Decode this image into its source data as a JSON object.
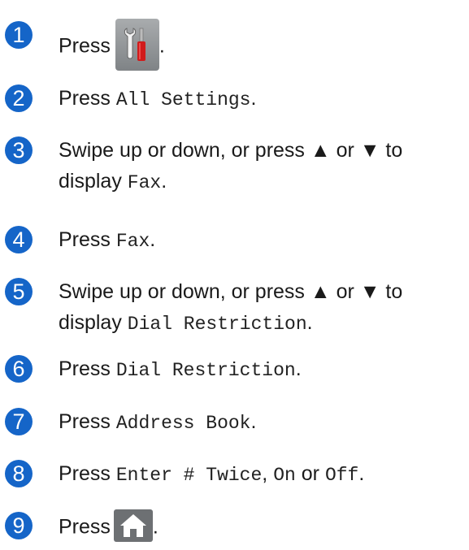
{
  "steps": [
    {
      "n": "1",
      "press": "Press",
      "after": "."
    },
    {
      "n": "2",
      "press": "Press",
      "code": "All Settings",
      "after": "."
    },
    {
      "n": "3",
      "line1": "Swipe up or down, or press ▲ or ▼ to",
      "line2a": "display",
      "code": "Fax",
      "after": "."
    },
    {
      "n": "4",
      "press": "Press",
      "code": "Fax",
      "after": "."
    },
    {
      "n": "5",
      "line1": "Swipe up or down, or press ▲ or ▼ to",
      "line2a": "display",
      "code": "Dial Restriction",
      "after": "."
    },
    {
      "n": "6",
      "press": "Press",
      "code": "Dial Restriction",
      "after": "."
    },
    {
      "n": "7",
      "press": "Press",
      "code": "Address Book",
      "after": "."
    },
    {
      "n": "8",
      "press": "Press",
      "code1": "Enter # Twice",
      "sep1": ", ",
      "code2": "On",
      "or": " or ",
      "code3": "Off",
      "after": "."
    },
    {
      "n": "9",
      "press": "Press",
      "after": "."
    }
  ],
  "icons": {
    "settings": "settings-tools-icon",
    "home": "home-icon"
  },
  "colors": {
    "step_circle": "#1565c8"
  }
}
